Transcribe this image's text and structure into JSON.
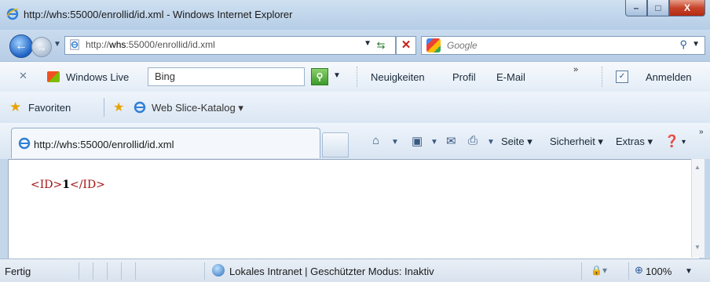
{
  "window": {
    "title": "http://whs:55000/enrollid/id.xml - Windows Internet Explorer",
    "controls": {
      "minimize": "–",
      "maximize": "□",
      "close": "X"
    }
  },
  "address_bar": {
    "url_prefix": "http://",
    "url_host": "whs",
    "url_rest": ":55000/enrollid/id.xml"
  },
  "search": {
    "placeholder": "Google"
  },
  "live_toolbar": {
    "brand": "Windows Live",
    "search_value": "Bing",
    "links": [
      "Neuigkeiten",
      "Profil",
      "E-Mail"
    ],
    "more": "»",
    "signin": "Anmelden"
  },
  "favorites_bar": {
    "favorites_label": "Favoriten",
    "web_slice_label": "Web Slice-Katalog ▾"
  },
  "tabs": [
    {
      "label": "http://whs:55000/enrollid/id.xml"
    }
  ],
  "command_bar": {
    "page": "Seite ▾",
    "safety": "Sicherheit ▾",
    "tools": "Extras ▾",
    "help": "▾"
  },
  "content": {
    "xml_open": "<ID>",
    "xml_value": "1",
    "xml_close": "</ID>"
  },
  "status_bar": {
    "status_text": "Fertig",
    "zone_text": "Lokales Intranet | Geschützter Modus: Inaktiv",
    "zoom": "100%"
  }
}
